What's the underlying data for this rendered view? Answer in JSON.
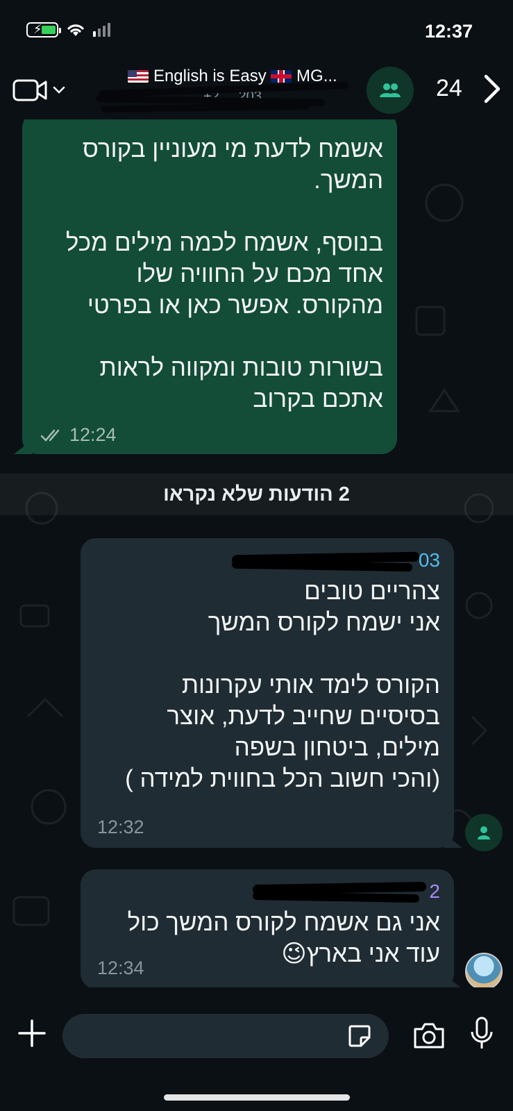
{
  "status_bar": {
    "time": "12:37",
    "icons": [
      "battery-charging-icon",
      "wifi-icon",
      "cellular-signal-icon"
    ]
  },
  "header": {
    "title": "English is Easy",
    "title_suffix": "MG...",
    "subtitle": "+2 ... 203",
    "unread_count": "24",
    "icons": [
      "video-call-icon",
      "chevron-down-icon",
      "group-icon",
      "chevron-right-icon"
    ]
  },
  "messages": {
    "outgoing_1": {
      "text": "אשמח לדעת מי מעוניין בקורס\nהמשך.\n\nבנוסף, אשמח לכמה מילים מכל\nאחד מכם על החוויה שלו\nמהקורס. אפשר כאן או בפרטי\n\nבשורות טובות ומקווה לראות\nאתכם בקרוב",
      "time": "12:24",
      "status_icon": "double-check-icon"
    },
    "unread_divider": "2 הודעות שלא נקראו",
    "incoming_1": {
      "sender": "03",
      "text": "צהריים טובים\nאני ישמח לקורס המשך\n\nהקורס  לימד אותי  עקרונות\nבסיסיים שחייב לדעת, אוצר\nמילים, ביטחון בשפה\n(והכי חשוב הכל בחווית למידה  )",
      "time": "12:32"
    },
    "incoming_2": {
      "sender": "2",
      "text": "אני גם אשמח לקורס המשך כול\nעוד אני בארץ😉",
      "time": "12:34"
    }
  },
  "input_bar": {
    "placeholder": "",
    "icons": [
      "plus-icon",
      "sticker-icon",
      "camera-icon",
      "microphone-icon"
    ]
  },
  "colors": {
    "background": "#0b1014",
    "outgoing_bubble": "#134d37",
    "incoming_bubble": "#202c33",
    "sender_1": "#53bdeb",
    "sender_2": "#a78bfa",
    "input_background": "#1f2c33"
  }
}
